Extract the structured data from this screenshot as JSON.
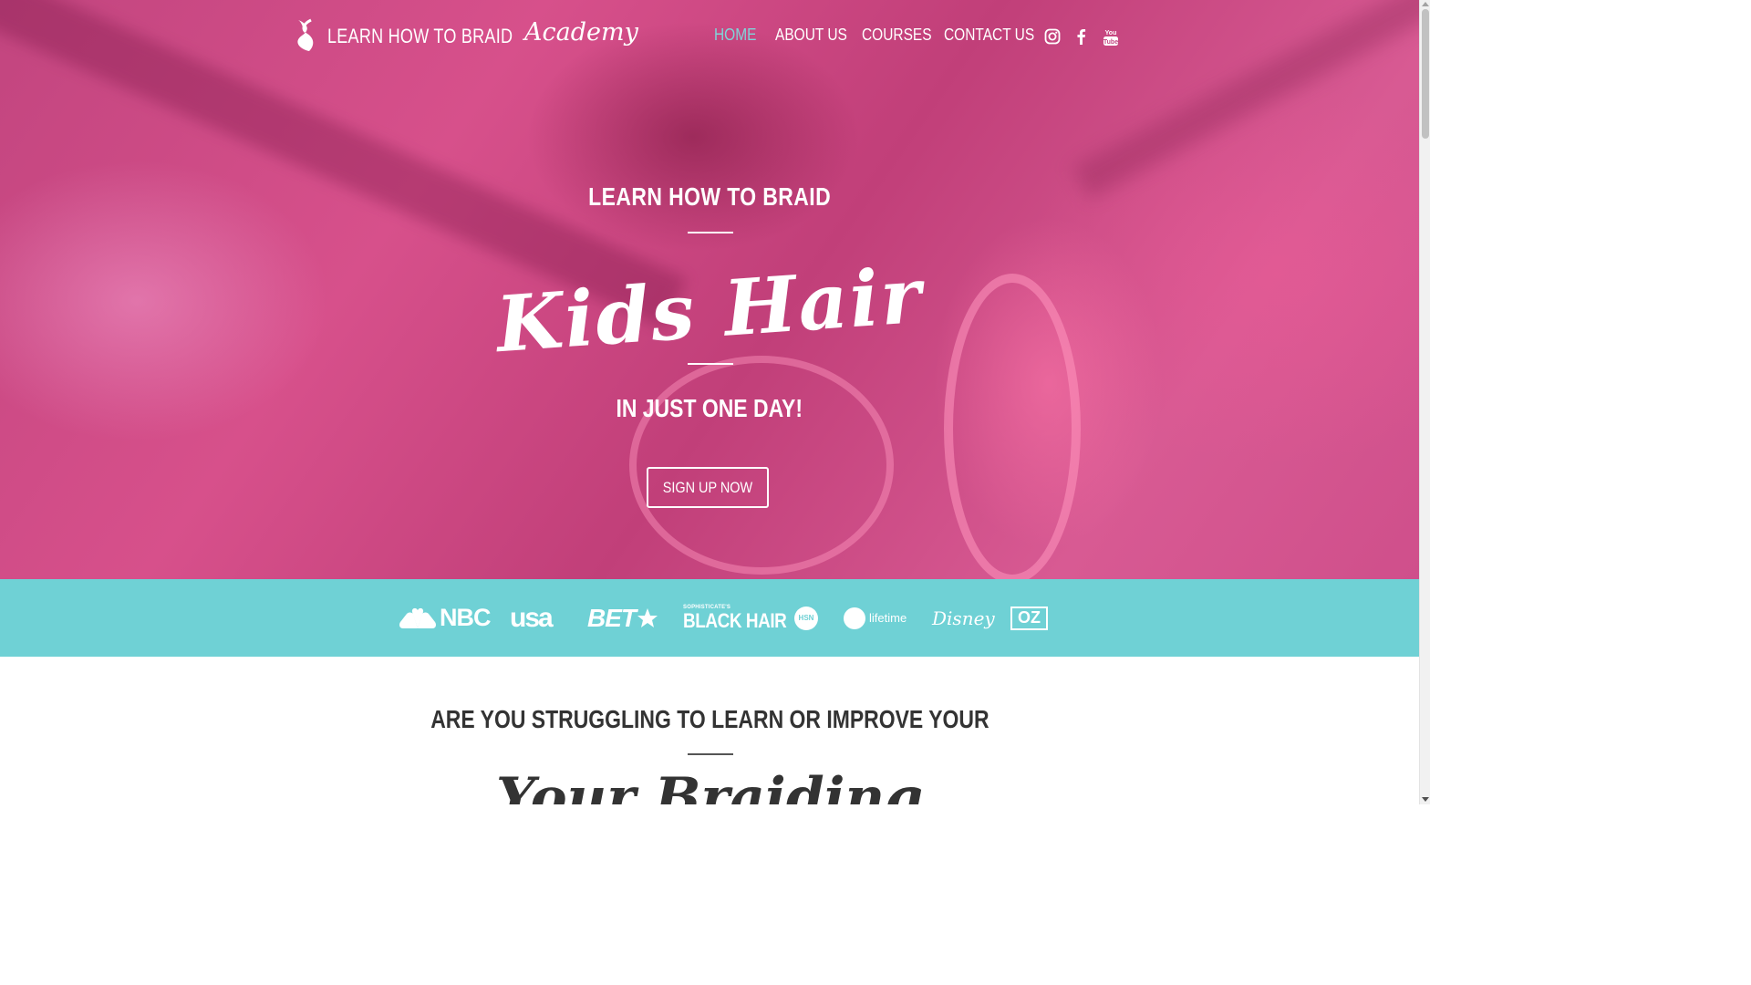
{
  "brand": {
    "name": "LEARN HOW TO BRAID",
    "script": "Academy",
    "logo_icon": "braid-logo-icon"
  },
  "nav": {
    "items": [
      {
        "label": "HOME",
        "active": true
      },
      {
        "label": "ABOUT US",
        "active": false
      },
      {
        "label": "COURSES",
        "active": false
      },
      {
        "label": "CONTACT US",
        "active": false
      }
    ],
    "active_color": "#7fd6da"
  },
  "social": [
    "instagram-icon",
    "facebook-icon",
    "youtube-icon"
  ],
  "hero": {
    "subtitle": "LEARN HOW TO BRAID",
    "script_title": "Kids Hair",
    "tagline": "IN JUST ONE DAY!",
    "cta": "SIGN UP NOW"
  },
  "featured": {
    "background": "#6fd1d5",
    "logos": [
      "NBC",
      "USA",
      "BET",
      "SOPHISTICATE'S",
      "BLACK HAIR",
      "HSN",
      "lifetime",
      "Disney",
      "OZ"
    ]
  },
  "section": {
    "question": "ARE YOU STRUGGLING TO LEARN OR IMPROVE YOUR",
    "script": "Your Braiding"
  },
  "colors": {
    "hero_overlay": "#d04f8b",
    "accent": "#7fd6da",
    "text_dark": "#333333"
  }
}
